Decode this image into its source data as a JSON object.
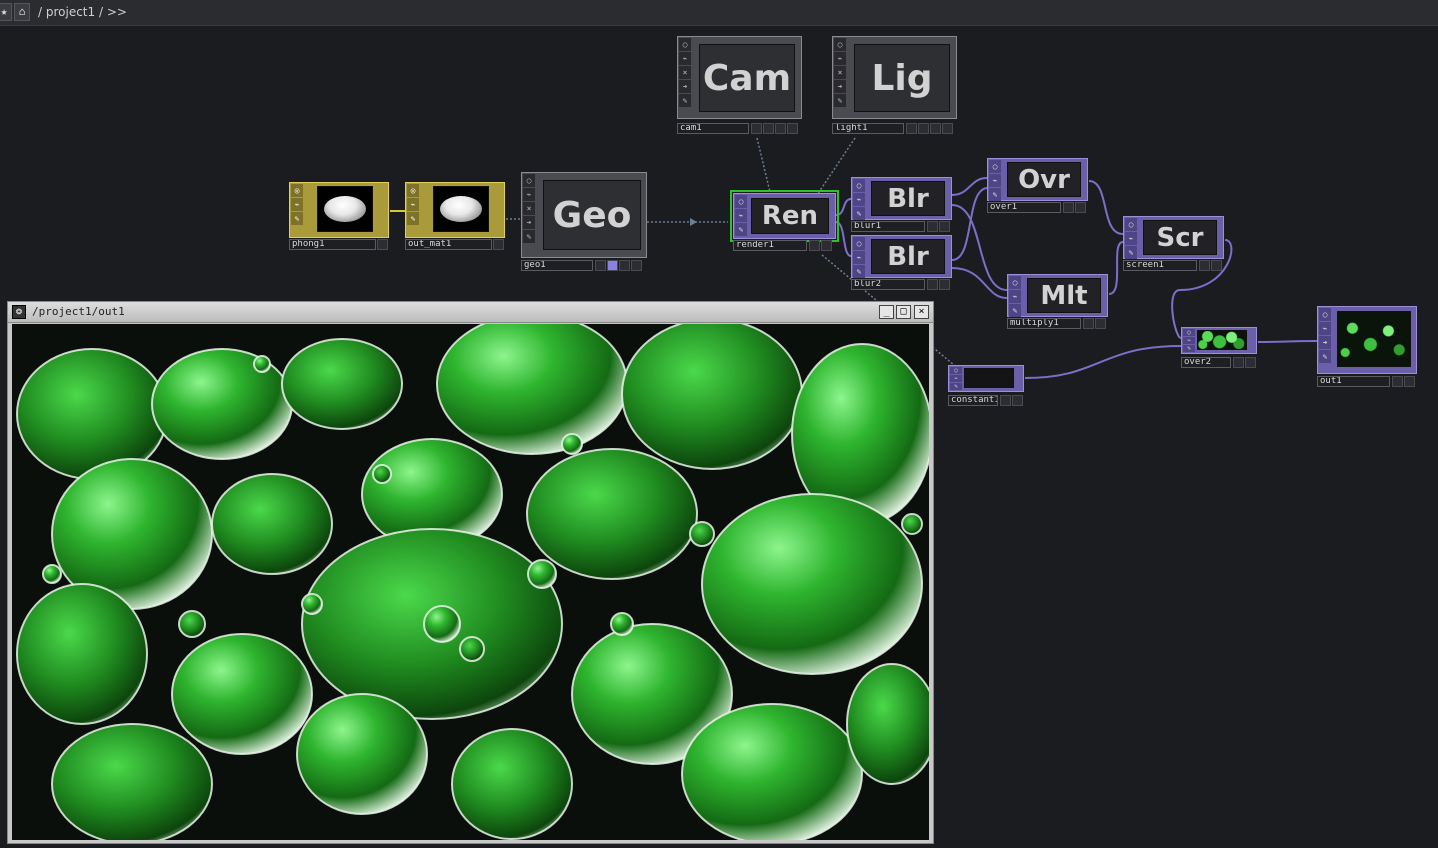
{
  "pathbar": {
    "path": "/ project1 / >>",
    "icons": [
      "pin-icon",
      "home-icon"
    ]
  },
  "nodes": {
    "phong1": {
      "label": "phong1",
      "type": "MAT"
    },
    "out_mat1": {
      "label": "out_mat1",
      "type": "MAT"
    },
    "geo1": {
      "label": "geo1",
      "title": "Geo",
      "type": "COMP"
    },
    "cam1": {
      "label": "cam1",
      "title": "Cam",
      "type": "COMP"
    },
    "light1": {
      "label": "light1",
      "title": "Lig",
      "type": "COMP"
    },
    "render1": {
      "label": "render1",
      "title": "Ren",
      "type": "TOP"
    },
    "blur1": {
      "label": "blur1",
      "title": "Blr",
      "type": "TOP"
    },
    "blur2": {
      "label": "blur2",
      "title": "Blr",
      "type": "TOP"
    },
    "over1": {
      "label": "over1",
      "title": "Ovr",
      "type": "TOP"
    },
    "multiply1": {
      "label": "multiply1",
      "title": "Mlt",
      "type": "TOP"
    },
    "screen1": {
      "label": "screen1",
      "title": "Scr",
      "type": "TOP"
    },
    "over2": {
      "label": "over2",
      "type": "TOP"
    },
    "constant1": {
      "label": "constant1",
      "type": "TOP"
    },
    "out1": {
      "label": "out1",
      "type": "TOP"
    }
  },
  "viewer": {
    "title": "/project1/out1",
    "buttons": {
      "minimize": "_",
      "maximize": "□",
      "close": "×"
    }
  },
  "colors": {
    "background": "#1b1c20",
    "top_family": "#6a5fa8",
    "mat_family": "#a99a3a",
    "comp_family": "#4a4b50",
    "selection": "#2fbf2f",
    "wire_top": "#7b6fc9",
    "wire_mat": "#d8c640",
    "blob_green": "#2faa2f"
  }
}
